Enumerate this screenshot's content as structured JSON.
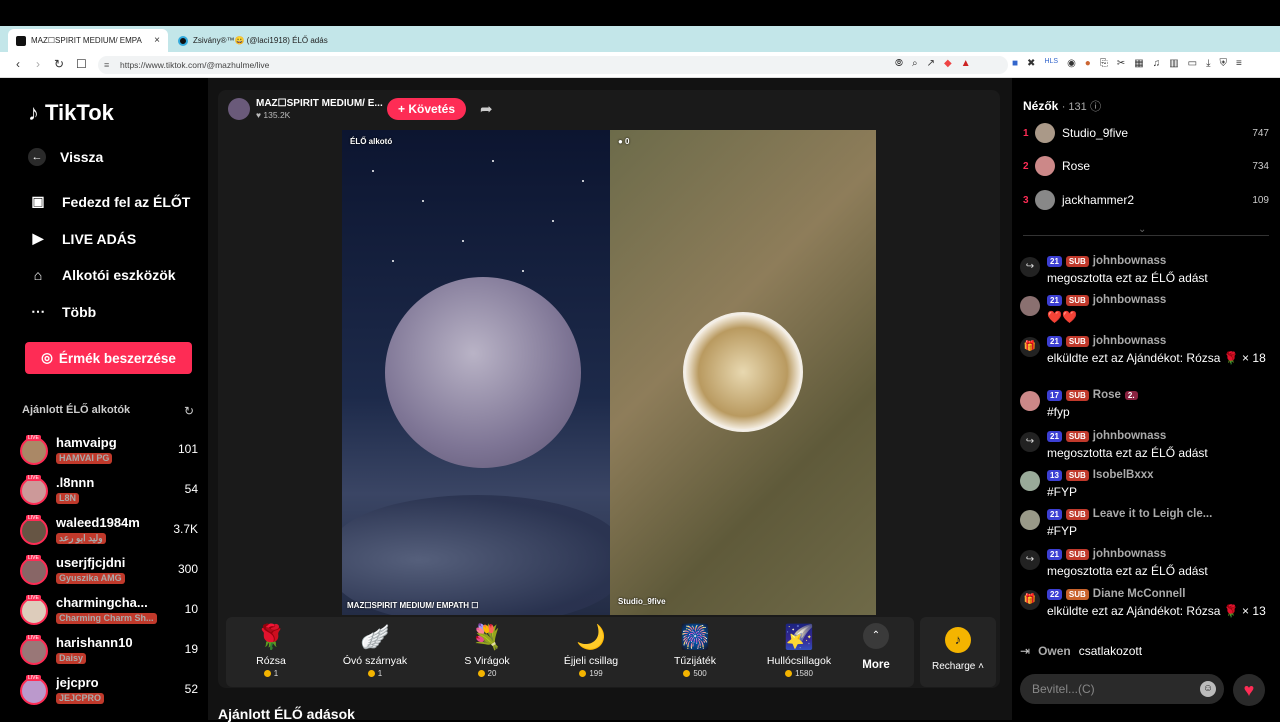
{
  "browser": {
    "tabs": [
      {
        "title": "MAZ☐SPIRIT MEDIUM/ EMPA",
        "close": "×"
      },
      {
        "title": "Zsivány®™😀 (@laci1918) ÉLŐ adás"
      }
    ],
    "new_tab": "+",
    "url": "https://www.tiktok.com/@mazhulme/live",
    "window_controls": [
      "–",
      "☐",
      "✕"
    ]
  },
  "sidebar": {
    "logo": "TikTok",
    "back": "Vissza",
    "nav": [
      {
        "label": "Fedezd fel az ÉLŐT",
        "icon": "▣"
      },
      {
        "label": "LIVE ADÁS",
        "icon": "▶"
      },
      {
        "label": "Alkotói eszközök",
        "icon": "⌂"
      },
      {
        "label": "Több",
        "icon": "⋯"
      }
    ],
    "coins_button": "Érmék beszerzése",
    "recommended_title": "Ajánlott ÉLŐ alkotók",
    "creators": [
      {
        "name": "hamvaipg",
        "sub": "HAMVAI PG",
        "viewers": "101",
        "live": "LIVE"
      },
      {
        "name": ".l8nnn",
        "sub": "L8N",
        "viewers": "54",
        "live": "LIVE"
      },
      {
        "name": "waleed1984m",
        "sub": "وليد ابو رعد",
        "viewers": "3.7K",
        "live": "LIVE"
      },
      {
        "name": "userjfjcjdni",
        "sub": "Gyuszika AMG",
        "viewers": "300",
        "live": "LIVE"
      },
      {
        "name": "charmingcha...",
        "sub": "Charming Charm Sh...",
        "viewers": "10",
        "live": "LIVE"
      },
      {
        "name": "harishann10",
        "sub": "Daisy",
        "viewers": "19",
        "live": "LIVE"
      },
      {
        "name": "jejcpro",
        "sub": "JEJCPRO",
        "viewers": "52",
        "live": "LIVE"
      }
    ]
  },
  "stream": {
    "host_name": "MAZ☐SPIRIT MEDIUM/ E...",
    "host_likes": "♥ 135.2K",
    "follow": "+ Követés",
    "left_label": "ÉLŐ alkotó",
    "left_bottom": "MAZ☐SPIRIT MEDIUM/ EMPATH ☐",
    "right_score": "● 0",
    "right_bottom": "Studio_9five",
    "gifts": [
      {
        "name": "Rózsa",
        "price": "1",
        "icon": "🌹"
      },
      {
        "name": "Óvó szárnyak",
        "price": "1",
        "icon": "🪽"
      },
      {
        "name": "S Virágok",
        "price": "20",
        "icon": "💐"
      },
      {
        "name": "Éjjeli csillag",
        "price": "199",
        "icon": "🌙"
      },
      {
        "name": "Tűzijáték",
        "price": "500",
        "icon": "🎆"
      },
      {
        "name": "Hullócsillagok",
        "price": "1580",
        "icon": "🌠"
      }
    ],
    "more": "More",
    "recharge": "Recharge ˄",
    "recommended_live": "Ajánlott ÉLŐ adások"
  },
  "chat": {
    "viewers_title": "Nézők",
    "viewers_count": "· 131",
    "top_viewers": [
      {
        "rank": "1",
        "name": "Studio_9five",
        "score": "747"
      },
      {
        "rank": "2",
        "name": "Rose",
        "score": "734"
      },
      {
        "rank": "3",
        "name": "jackhammer2",
        "score": "109"
      }
    ],
    "messages": [
      {
        "icon": "↪",
        "level": "21",
        "sub": "SUB",
        "user": "johnbownass",
        "text": "megosztotta ezt az ÉLŐ adást"
      },
      {
        "icon": "",
        "level": "21",
        "sub": "SUB",
        "user": "johnbownass",
        "text": "❤️❤️"
      },
      {
        "icon": "🎁",
        "level": "21",
        "sub": "SUB",
        "user": "johnbownass",
        "text": "elküldte ezt az Ajándékot: Rózsa 🌹 × 18"
      },
      {
        "icon": "",
        "level": "17",
        "sub": "SUB",
        "user": "Rose",
        "badge": "2.",
        "text": "#fyp"
      },
      {
        "icon": "↪",
        "level": "21",
        "sub": "SUB",
        "user": "johnbownass",
        "text": "megosztotta ezt az ÉLŐ adást"
      },
      {
        "icon": "",
        "level": "13",
        "sub": "SUB",
        "user": "IsobelBxxx",
        "text": "#FYP"
      },
      {
        "icon": "",
        "level": "21",
        "sub": "SUB",
        "user": "Leave it to Leigh cle...",
        "text": "#FYP"
      },
      {
        "icon": "↪",
        "level": "21",
        "sub": "SUB",
        "user": "johnbownass",
        "text": "megosztotta ezt az ÉLŐ adást"
      },
      {
        "icon": "🎁",
        "level": "22",
        "sub": "SUB",
        "user": "Diane McConnell",
        "text": "elküldte ezt az Ajándékot: Rózsa 🌹 × 13"
      }
    ],
    "joined_user": "Owen",
    "joined_text": "csatlakozott",
    "input_placeholder": "Bevitel...(C)"
  }
}
